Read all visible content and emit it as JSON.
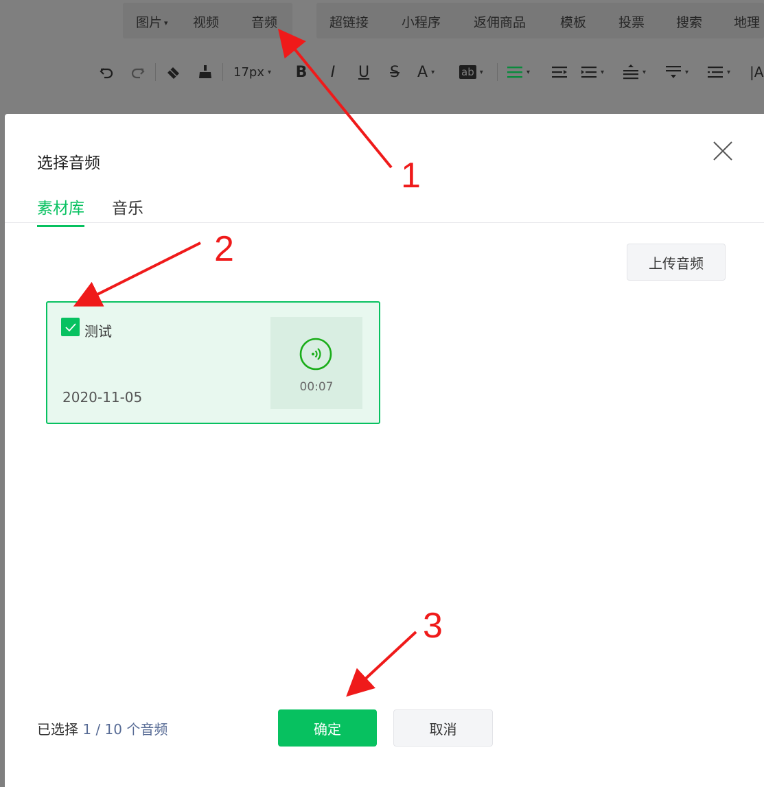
{
  "menu": {
    "items": [
      {
        "label": "图片",
        "has_caret": true
      },
      {
        "label": "视频"
      },
      {
        "label": "音频"
      },
      {
        "label": "超链接"
      },
      {
        "label": "小程序"
      },
      {
        "label": "返佣商品"
      },
      {
        "label": "模板"
      },
      {
        "label": "投票"
      },
      {
        "label": "搜索"
      },
      {
        "label": "地理"
      }
    ]
  },
  "toolbar": {
    "font_size": "17px",
    "bold_label": "B",
    "italic_label": "I",
    "underline_label": "U",
    "strike_label": "S",
    "font_color_label": "A",
    "bg_color_label": "ab",
    "letter_spacing_label": "|A"
  },
  "dialog": {
    "title": "选择音频",
    "tabs": [
      {
        "label": "素材库",
        "active": true
      },
      {
        "label": "音乐",
        "active": false
      }
    ],
    "upload_label": "上传音频",
    "audio_items": [
      {
        "name": "测试",
        "date": "2020-11-05",
        "duration": "00:07",
        "checked": true
      }
    ],
    "footer": {
      "prefix": "已选择",
      "count": "1 / 10 个音频",
      "confirm_label": "确定",
      "cancel_label": "取消"
    }
  },
  "annotations": {
    "step1": "1",
    "step2": "2",
    "step3": "3",
    "color": "#ef1a1a"
  },
  "colors": {
    "accent": "#07c160",
    "link": "#576b95",
    "mask": "#7f7f7f"
  }
}
